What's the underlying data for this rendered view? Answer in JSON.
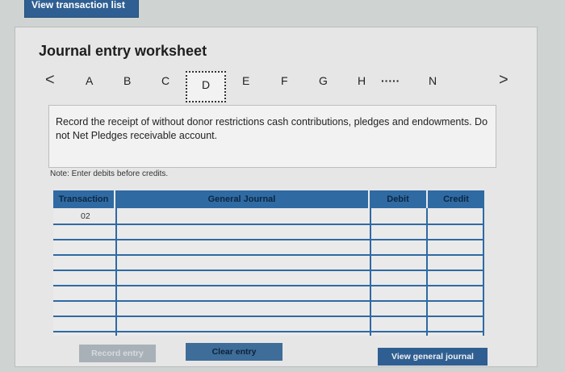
{
  "top": {
    "view_transaction_list": "View transaction list"
  },
  "worksheet": {
    "title": "Journal entry worksheet",
    "nav": {
      "prev": "<",
      "next": ">",
      "tabs": [
        "A",
        "B",
        "C",
        "D",
        "E",
        "F",
        "G",
        "H",
        "N"
      ],
      "ellipsis": "·····",
      "active_tab": "D"
    },
    "instruction": "Record the receipt of without donor restrictions cash contributions, pledges and endowments. Do not Net Pledges receivable account.",
    "note": "Note: Enter debits before credits."
  },
  "table": {
    "headers": {
      "transaction": "Transaction",
      "general_journal": "General Journal",
      "debit": "Debit",
      "credit": "Credit"
    },
    "transaction_value": "02"
  },
  "buttons": {
    "record": "Record entry",
    "clear": "Clear entry",
    "view_journal": "View general journal"
  },
  "colors": {
    "accent": "#2f6aa3",
    "button_blue": "#2f5f92"
  }
}
